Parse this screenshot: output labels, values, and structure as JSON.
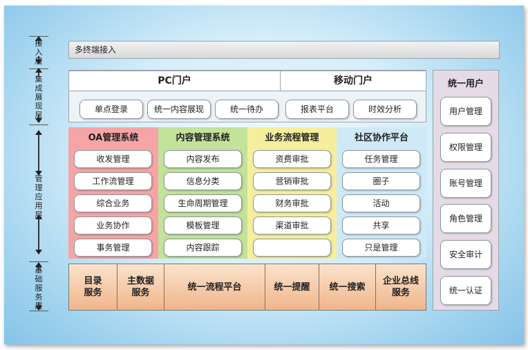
{
  "layers": [
    {
      "label": "接入层"
    },
    {
      "label": "集成展现层"
    },
    {
      "label": "管理应用层"
    },
    {
      "label": "基础服务层"
    }
  ],
  "access": {
    "label": "多终端接入"
  },
  "portals": {
    "pc": "PC门户",
    "mobile": "移动门户",
    "items": [
      "单点登录",
      "统一内容展现",
      "统一待办",
      "报表平台",
      "时效分析"
    ]
  },
  "columns": [
    {
      "title": "OA管理系统",
      "color": "#f6a5a6",
      "items": [
        "收发管理",
        "工作流管理",
        "综合业务",
        "业务协作",
        "事务管理"
      ]
    },
    {
      "title": "内容管理系统",
      "color": "#c3e29a",
      "items": [
        "内容发布",
        "信息分类",
        "生命周期管理",
        "模板管理",
        "内容跟踪"
      ]
    },
    {
      "title": "业务流程管理",
      "color": "#f5ef9d",
      "items": [
        "资费审批",
        "营销审批",
        "财务审批",
        "渠道审批",
        ""
      ]
    },
    {
      "title": "社区协作平台",
      "color": "#cfeaf6",
      "items": [
        "任务管理",
        "圈子",
        "活动",
        "共享",
        "只是管理"
      ]
    }
  ],
  "base": [
    {
      "line1": "目录",
      "line2": "服务"
    },
    {
      "line1": "主数据",
      "line2": "服务"
    },
    {
      "line1": "统一流程平台",
      "line2": ""
    },
    {
      "line1": "统一提醒",
      "line2": ""
    },
    {
      "line1": "统一搜索",
      "line2": ""
    },
    {
      "line1": "企业总线",
      "line2": "服务"
    }
  ],
  "user": {
    "title": "统一用户",
    "items": [
      "用户管理",
      "权限管理",
      "账号管理",
      "角色管理",
      "安全审计",
      "统一认证"
    ]
  }
}
